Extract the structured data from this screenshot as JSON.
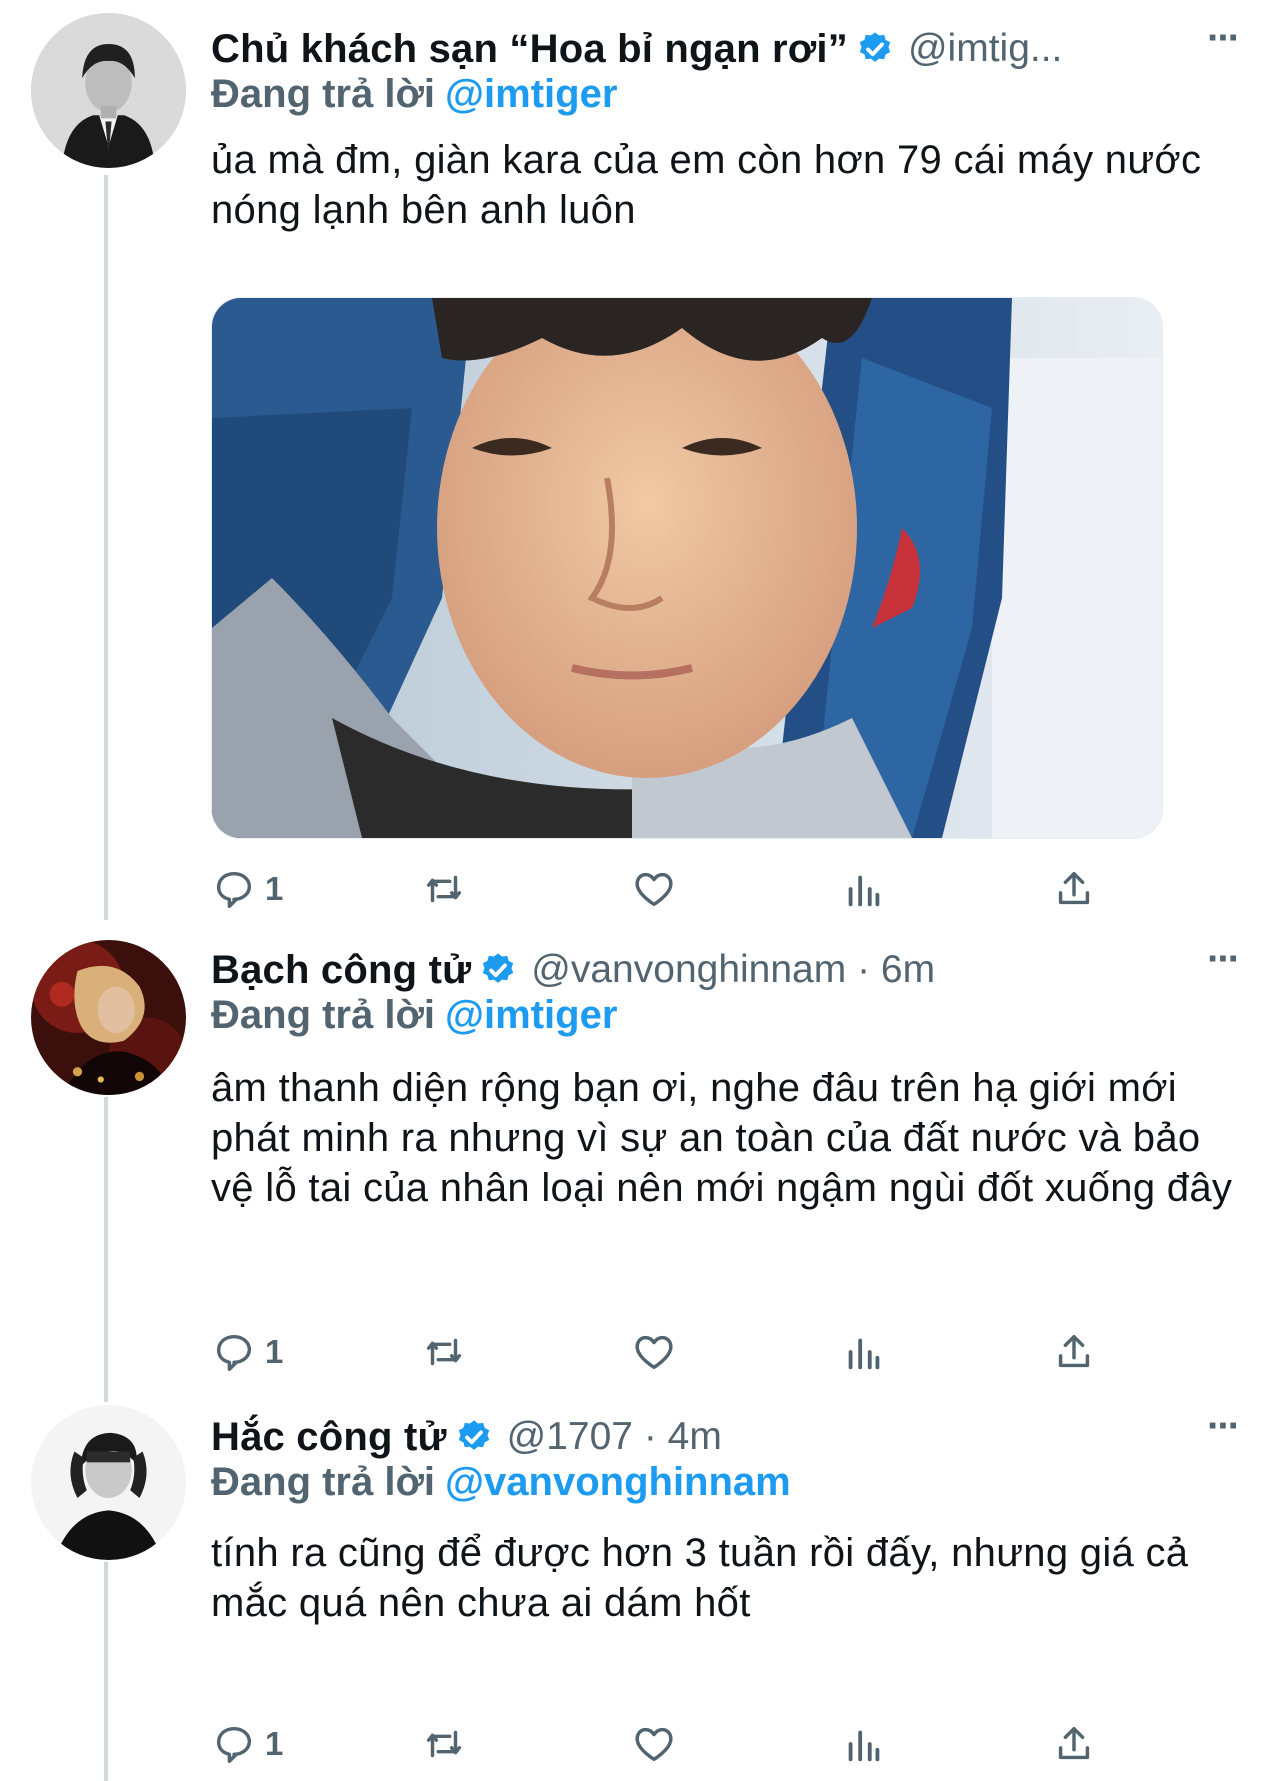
{
  "tweets": [
    {
      "display_name": "Chủ khách sạn “Hoa bỉ ngạn rơi”",
      "handle": "@imtig...",
      "replying_label": "Đang trả lời",
      "replying_to": "@imtiger",
      "text": "ủa mà đm, giàn kara của em còn hơn 79 cái máy nước nóng lạnh bên anh luôn",
      "reply_count": "1",
      "more_label": "···"
    },
    {
      "display_name": "Bạch công tử",
      "handle": "@vanvonghinnam · 6m",
      "replying_label": "Đang trả lời",
      "replying_to": "@imtiger",
      "text": "âm thanh diện rộng bạn ơi, nghe đâu trên hạ giới mới phát minh ra nhưng vì  sự an toàn của đất nước và bảo vệ lỗ tai của nhân loại nên mới ngậm ngùi đốt xuống đây",
      "reply_count": "1",
      "more_label": "···"
    },
    {
      "display_name": "Hắc công tử",
      "handle": "@1707 · 4m",
      "replying_label": "Đang trả lời",
      "replying_to": "@vanvonghinnam",
      "text": "tính ra cũng để được hơn 3 tuần rồi đấy, nhưng giá cả mắc quá nên chưa ai dám hốt",
      "reply_count": "1",
      "more_label": "···"
    }
  ],
  "colors": {
    "accent": "#1d9bf0",
    "secondary_text": "#536471",
    "thread_line": "#cfd9de"
  },
  "icons": [
    "verified-badge-icon",
    "reply-icon",
    "retweet-icon",
    "like-icon",
    "analytics-icon",
    "share-icon",
    "more-icon"
  ]
}
